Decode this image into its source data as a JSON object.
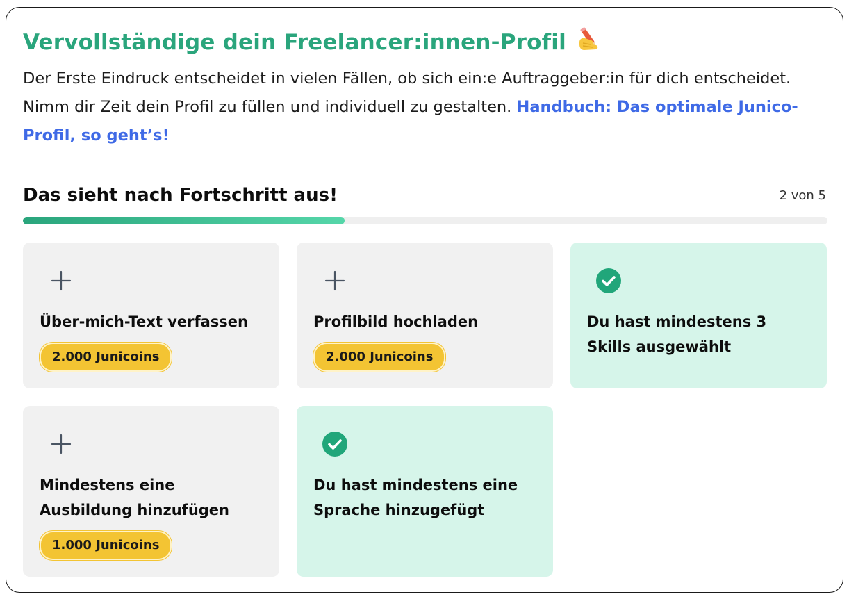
{
  "header": {
    "title": "Vervollständige dein Freelancer:innen-Profil",
    "title_emoji": "writing-hand-icon",
    "description": "Der Erste Eindruck entscheidet in vielen Fällen, ob sich ein:e Auftraggeber:in für dich entscheidet. Nimm dir Zeit dein Profil zu füllen und individuell zu gestalten.",
    "handbook_link": "Handbuch: Das optimale Junico-Profil, so geht’s!"
  },
  "progress": {
    "title": "Das sieht nach Fortschritt aus!",
    "count_label": "2 von 5",
    "completed": 2,
    "total": 5
  },
  "tasks": [
    {
      "label": "Über-mich-Text verfassen",
      "reward": "2.000 Junicoins",
      "done": false,
      "icon": "plus-icon"
    },
    {
      "label": "Profilbild hochladen",
      "reward": "2.000 Junicoins",
      "done": false,
      "icon": "plus-icon"
    },
    {
      "label": "Du hast mindestens 3 Skills ausgewählt",
      "reward": "",
      "done": true,
      "icon": "check-circle-icon"
    },
    {
      "label": "Mindestens eine Ausbildung hinzufügen",
      "reward": "1.000 Junicoins",
      "done": false,
      "icon": "plus-icon"
    },
    {
      "label": "Du hast mindestens eine Sprache hinzugefügt",
      "reward": "",
      "done": true,
      "icon": "check-circle-icon"
    }
  ],
  "colors": {
    "accent_green": "#2aa57c",
    "link_blue": "#3f6ae6",
    "done_background": "#d6f5ea",
    "todo_background": "#f1f1f1",
    "badge_yellow": "#f3c433"
  }
}
